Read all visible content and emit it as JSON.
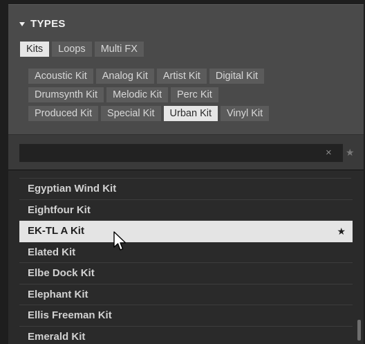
{
  "types": {
    "title": "TYPES",
    "categories": [
      {
        "label": "Kits",
        "selected": true
      },
      {
        "label": "Loops",
        "selected": false
      },
      {
        "label": "Multi FX",
        "selected": false
      }
    ],
    "subtypes_rows": [
      [
        {
          "label": "Acoustic Kit",
          "selected": false
        },
        {
          "label": "Analog Kit",
          "selected": false
        },
        {
          "label": "Artist Kit",
          "selected": false
        },
        {
          "label": "Digital Kit",
          "selected": false
        }
      ],
      [
        {
          "label": "Drumsynth Kit",
          "selected": false
        },
        {
          "label": "Melodic Kit",
          "selected": false
        },
        {
          "label": "Perc Kit",
          "selected": false
        }
      ],
      [
        {
          "label": "Produced Kit",
          "selected": false
        },
        {
          "label": "Special Kit",
          "selected": false
        },
        {
          "label": "Urban Kit",
          "selected": true
        },
        {
          "label": "Vinyl Kit",
          "selected": false
        }
      ]
    ]
  },
  "search": {
    "value": "",
    "placeholder": "",
    "clear_glyph": "×",
    "favorites_glyph": "★"
  },
  "results": [
    {
      "name": "Egyptian Wind Kit",
      "selected": false,
      "favorite": false
    },
    {
      "name": "Eightfour Kit",
      "selected": false,
      "favorite": false
    },
    {
      "name": "EK-TL A Kit",
      "selected": true,
      "favorite": true
    },
    {
      "name": "Elated Kit",
      "selected": false,
      "favorite": false
    },
    {
      "name": "Elbe Dock Kit",
      "selected": false,
      "favorite": false
    },
    {
      "name": "Elephant Kit",
      "selected": false,
      "favorite": false
    },
    {
      "name": "Ellis Freeman Kit",
      "selected": false,
      "favorite": false
    },
    {
      "name": "Emerald Kit",
      "selected": false,
      "favorite": false
    }
  ],
  "icons": {
    "collapse": "triangle-down-icon",
    "clear": "close-icon",
    "favorites": "star-icon",
    "pointer": "mouse-pointer-icon"
  },
  "colors": {
    "panel": "#4a4a4a",
    "chip": "#5b5b5b",
    "chip_selected": "#e6e6e6",
    "list_bg": "#2a2a2a",
    "row_selected": "#e4e4e4"
  }
}
